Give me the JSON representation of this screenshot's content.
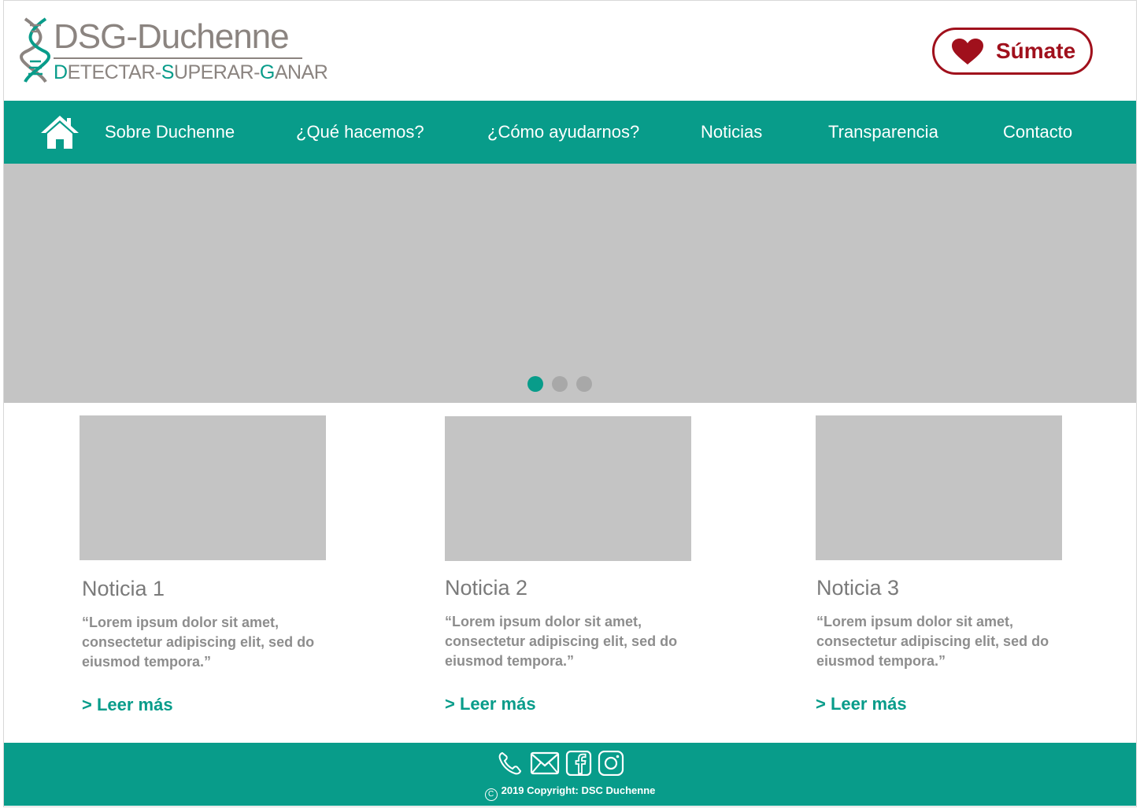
{
  "brand": {
    "name": "DSG-Duchenne",
    "tagline_parts": [
      {
        "text": "D",
        "accent": true
      },
      {
        "text": "ETECTAR-",
        "accent": false
      },
      {
        "text": "S",
        "accent": true
      },
      {
        "text": "UPERAR-",
        "accent": false
      },
      {
        "text": "G",
        "accent": true
      },
      {
        "text": "ANAR",
        "accent": false
      }
    ]
  },
  "header": {
    "cta_label": "Súmate",
    "cta_icon": "heart-icon"
  },
  "nav": {
    "home_icon": "home-icon",
    "items": [
      {
        "label": "Sobre Duchenne"
      },
      {
        "label": "¿Qué hacemos?"
      },
      {
        "label": "¿Cómo ayudarnos?"
      },
      {
        "label": "Noticias"
      },
      {
        "label": "Transparencia"
      },
      {
        "label": "Contacto"
      }
    ]
  },
  "hero": {
    "slides_count": 3,
    "active_slide": 1
  },
  "news": [
    {
      "title": "Noticia 1",
      "excerpt": "“Lorem ipsum dolor sit amet, consectetur adipiscing elit, sed do eiusmod tempora.”",
      "link": "> Leer más"
    },
    {
      "title": "Noticia 2",
      "excerpt": "“Lorem ipsum dolor sit amet, consectetur adipiscing elit, sed do eiusmod tempora.”",
      "link": "> Leer más"
    },
    {
      "title": "Noticia 3",
      "excerpt": "“Lorem ipsum dolor sit amet, consectetur adipiscing elit, sed do eiusmod tempora.”",
      "link": "> Leer más"
    }
  ],
  "footer": {
    "icons": [
      "phone-icon",
      "mail-icon",
      "facebook-icon",
      "instagram-icon"
    ],
    "copyright_symbol": "C",
    "copyright": "2019 Copyright: DSC Duchenne"
  },
  "colors": {
    "brand_teal": "#089c8a",
    "cta_red": "#a0101c",
    "logo_gray": "#8b8480",
    "placeholder_gray": "#c4c4c4",
    "dot_inactive": "#a8a8a8"
  }
}
